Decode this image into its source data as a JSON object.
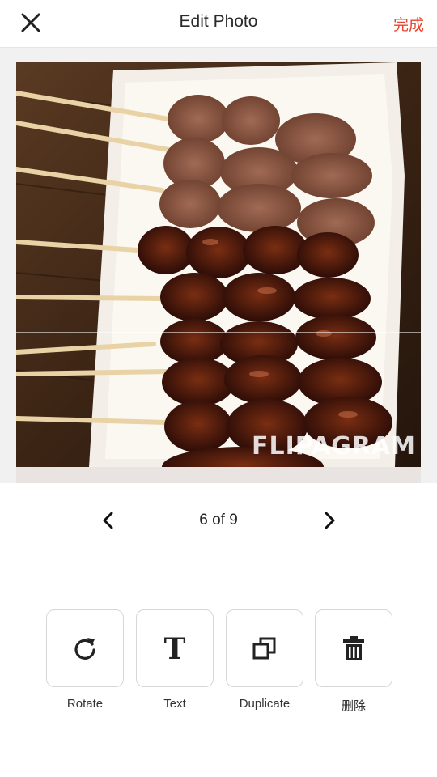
{
  "header": {
    "title": "Edit Photo",
    "done_label": "完成",
    "close_icon": "close-icon"
  },
  "photo": {
    "watermark": "FLIPAGRAM",
    "description_icon": "skewers-photo"
  },
  "pager": {
    "label": "6 of 9",
    "prev_icon": "chevron-left-icon",
    "next_icon": "chevron-right-icon"
  },
  "tools": {
    "rotate_label": "Rotate",
    "text_label": "Text",
    "duplicate_label": "Duplicate",
    "delete_label": "删除"
  },
  "colors": {
    "accent": "#e8452f",
    "border": "#d6d6d6"
  }
}
